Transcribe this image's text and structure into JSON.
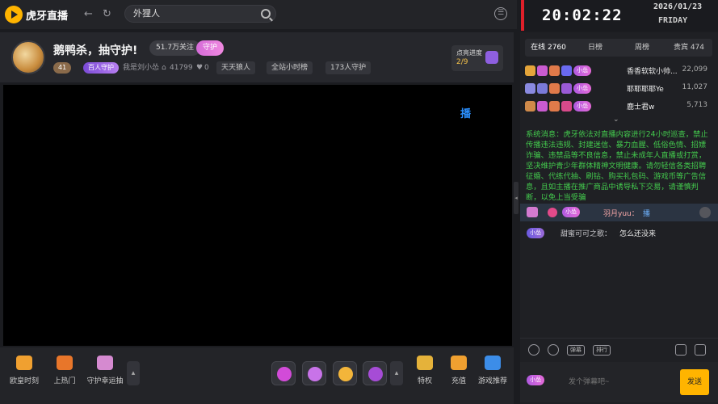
{
  "topbar": {
    "logo_text": "虎牙直播",
    "back_icon": "←",
    "refresh_icon": "↻",
    "search_value": "外狸人",
    "menu_icon": "☰"
  },
  "room": {
    "title": "鹅鸭杀，抽守护!",
    "followers": "51.7万关注",
    "guard_label": "守护",
    "level": "41",
    "badge": "百人守护",
    "streamer": "我是刘小怂",
    "popularity": "41799",
    "likes": "0",
    "tags": [
      "天天狼人",
      "全站小时榜",
      "173人守护"
    ],
    "progress_label": "点亮进度",
    "progress_value": "2/9"
  },
  "video": {
    "watermark": "播"
  },
  "bottom": {
    "left_items": [
      "欧皇时刻",
      "上热门",
      "守护幸运抽"
    ],
    "right_items": [
      "特权",
      "充值",
      "游戏推荐"
    ],
    "gift_colors": [
      "#d24bd8",
      "#c873e8",
      "#f3b53a",
      "#a64cd6"
    ]
  },
  "clock": {
    "time": "20:02:22",
    "date": "2026/01/23",
    "weekday": "FRIDAY"
  },
  "sidebar": {
    "tabs": [
      "在线 2760",
      "日榜",
      "周榜",
      "贵宾 474"
    ],
    "ranks": [
      {
        "name": "香香软软小帅...",
        "score": "22,099"
      },
      {
        "name": "耶耶耶耶Ye",
        "score": "11,027"
      },
      {
        "name": "鹿士君w",
        "score": "5,713"
      }
    ],
    "rank_pill": "小怂",
    "system_message": "系统消息：虎牙依法对直播内容进行24小时巡查，禁止传播违法违规、封建迷信、暴力血腥、低俗色情、招嫖诈骗、违禁品等不良信息，禁止未成年人直播或打赏，坚决维护青少年群体精神文明健康。请勿轻信各类招聘征婚、代练代抽、刷钻、购买礼包码、游戏币等广告信息，且如主播在推广商品中诱导私下交易，请谨慎判断，以免上当受骗",
    "msg1": {
      "user": "羽月yuu：",
      "text": "播"
    },
    "msg2": {
      "user": "甜蜜可可之歌：",
      "text": "怎么还没来"
    },
    "chat_placeholder": "发个弹幕吧~",
    "send_label": "发送",
    "toolbar_pills": [
      "弹幕",
      "排行"
    ]
  }
}
